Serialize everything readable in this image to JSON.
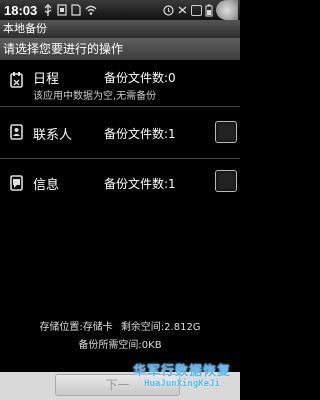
{
  "status_bar": {
    "time": "18:03",
    "notification_icons": [
      "usb-icon",
      "sim-icon",
      "sd-icon",
      "wifi-icon"
    ],
    "right_icons": [
      "alarm-icon",
      "sync-icon",
      "signal-icon",
      "battery-icon"
    ]
  },
  "window": {
    "title": "本地备份",
    "prompt": "请选择您要进行的操作"
  },
  "items": [
    {
      "name": "日程",
      "count": "备份文件数:0",
      "subtitle": "该应用中数据为空,无需备份",
      "checkbox": false,
      "icon": "calendar-icon"
    },
    {
      "name": "联系人",
      "count": "备份文件数:1",
      "subtitle": "",
      "checkbox": true,
      "icon": "contacts-icon"
    },
    {
      "name": "信息",
      "count": "备份文件数:1",
      "subtitle": "",
      "checkbox": true,
      "icon": "messages-icon"
    }
  ],
  "footer": {
    "storage_location": "存储位置:存储卡",
    "free_space": "剩余空间:2.812G",
    "required_space": "备份所需空间:0KB",
    "next_label": "下一"
  },
  "watermark": {
    "cn": "华军行数据恢复",
    "en": "HuaJunXingKeJi"
  }
}
